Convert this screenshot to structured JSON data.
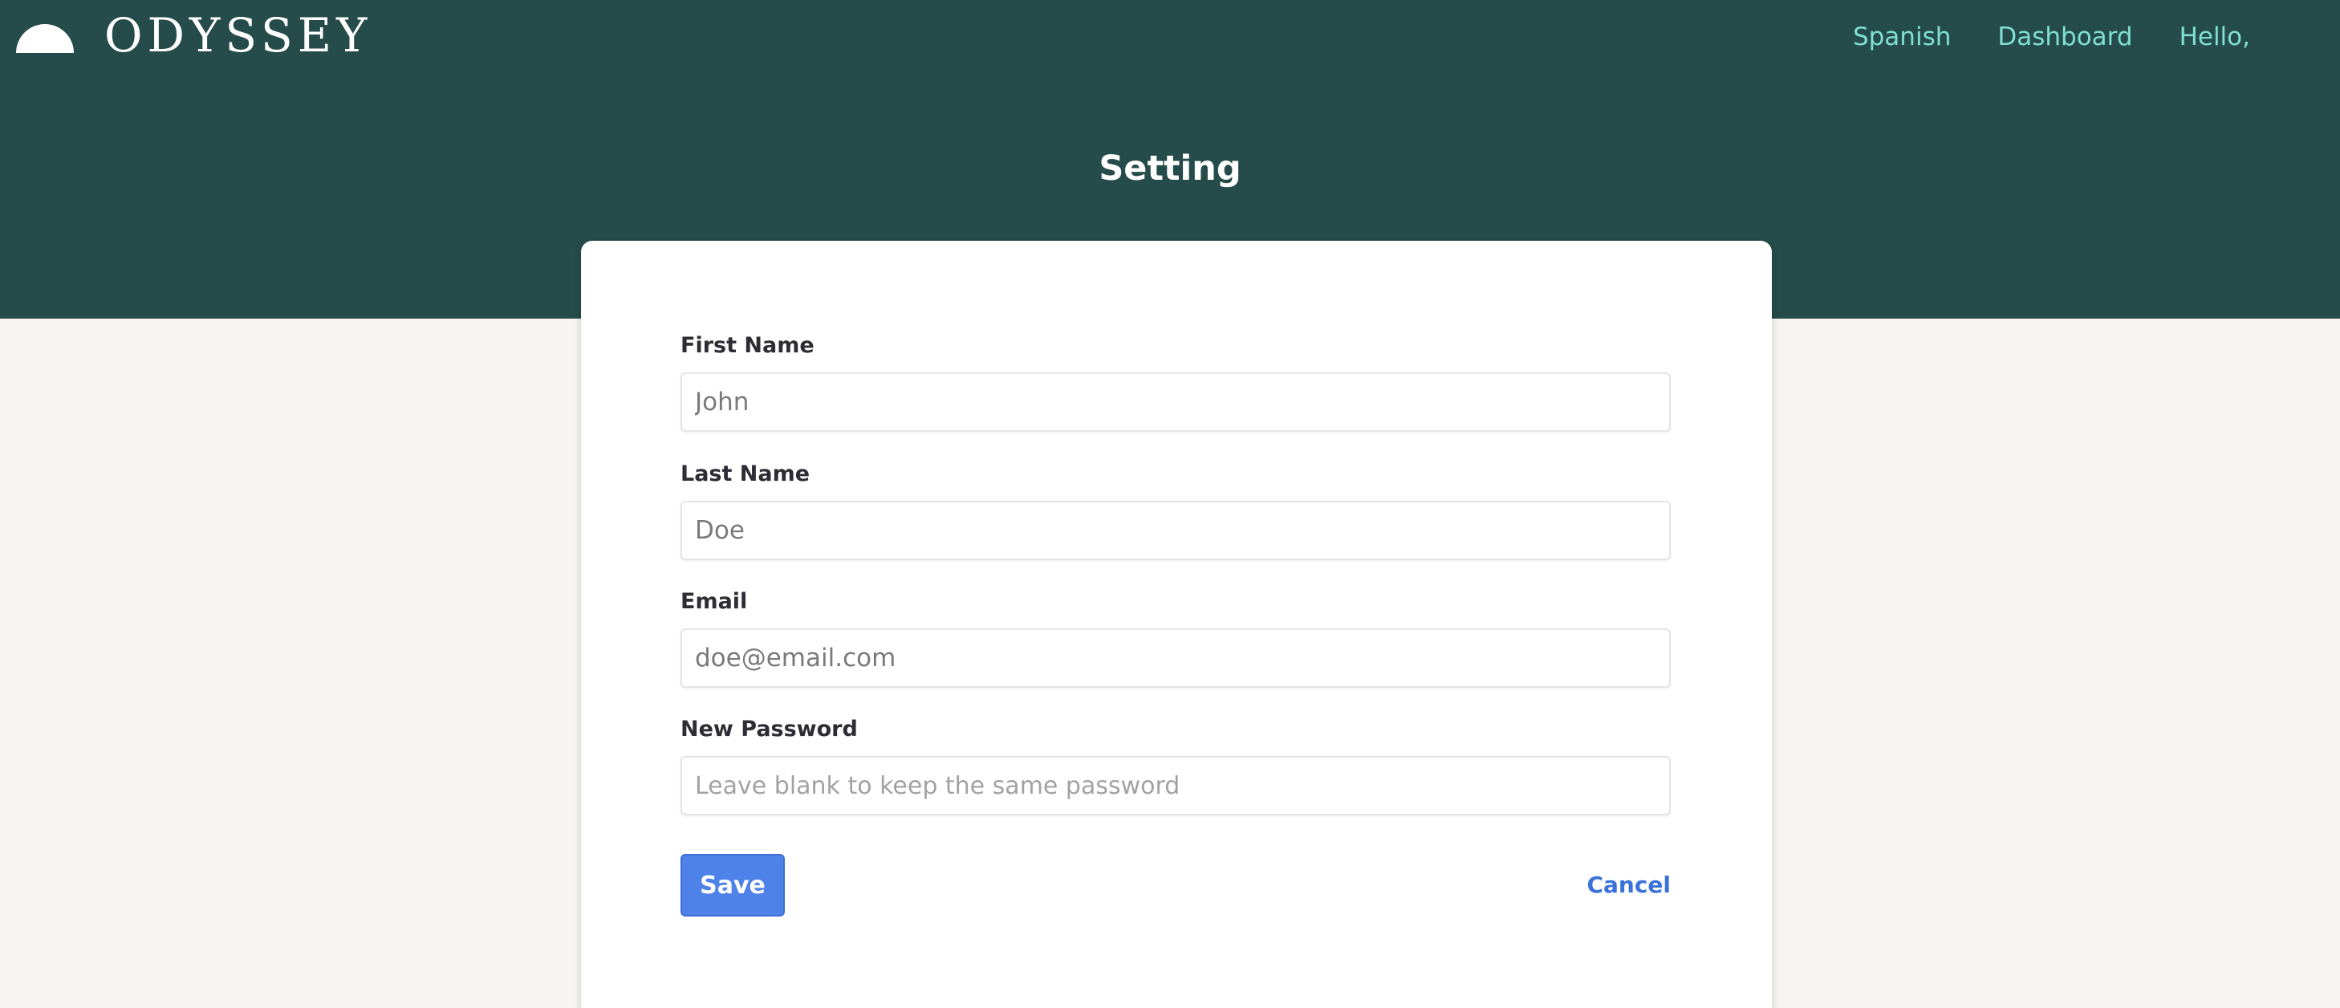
{
  "brand": {
    "name": "ODYSSEY",
    "logo_icon": "half-sun-icon"
  },
  "nav": {
    "items": [
      {
        "label": "Spanish"
      },
      {
        "label": "Dashboard"
      },
      {
        "label": "Hello,"
      }
    ]
  },
  "page": {
    "title": "Setting"
  },
  "form": {
    "first_name": {
      "label": "First Name",
      "value": "John"
    },
    "last_name": {
      "label": "Last Name",
      "value": "Doe"
    },
    "email": {
      "label": "Email",
      "value": "doe@email.com"
    },
    "new_password": {
      "label": "New Password",
      "value": "",
      "placeholder": "Leave blank to keep the same password"
    },
    "save_label": "Save",
    "cancel_label": "Cancel"
  },
  "colors": {
    "header_bg": "#254c4a",
    "nav_link": "#7fe0d2",
    "page_bg": "#f6f5f1",
    "primary_button": "#4f82e8",
    "cancel_link": "#3b72d9"
  }
}
